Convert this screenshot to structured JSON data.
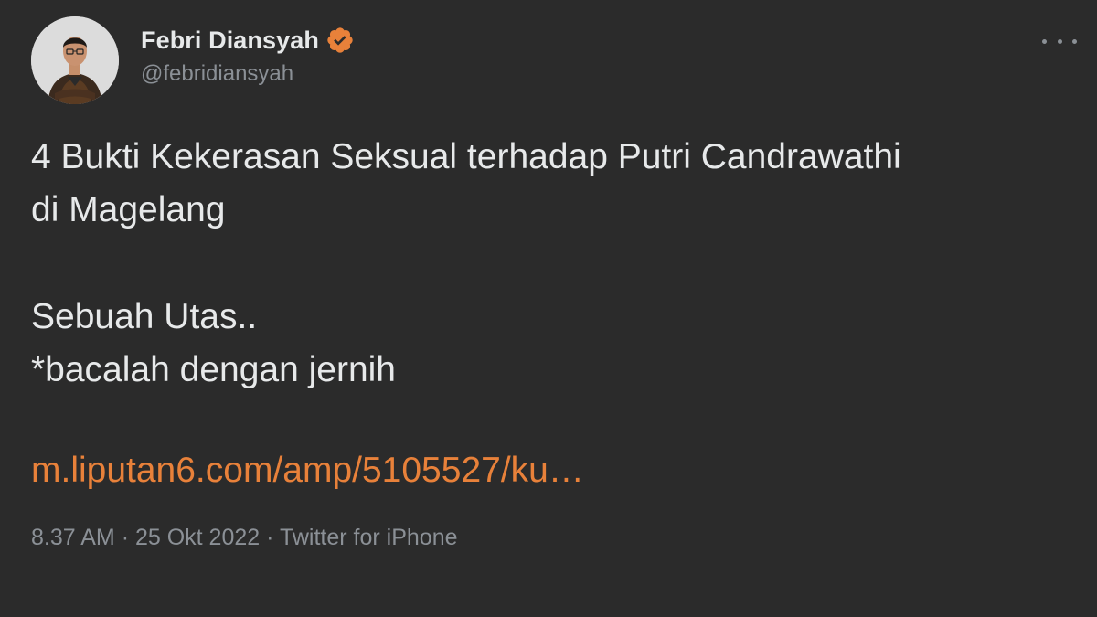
{
  "author": {
    "display_name": "Febri Diansyah",
    "handle": "@febridiansyah",
    "verified": true
  },
  "tweet": {
    "lines": [
      "4 Bukti Kekerasan Seksual terhadap Putri Candrawathi",
      "di Magelang",
      "Sebuah Utas..",
      "*bacalah dengan jernih"
    ],
    "link_text": "m.liputan6.com/amp/5105527/ku…"
  },
  "meta": {
    "time": "8.37 AM",
    "separator": "·",
    "date": "25 Okt 2022",
    "source": "Twitter for iPhone"
  },
  "colors": {
    "background": "#2b2b2b",
    "text": "#e7e9ea",
    "muted": "#8b9096",
    "accent": "#e8813a",
    "verified_badge": "#e8813a"
  },
  "icons": {
    "verified": "verified-badge-icon",
    "more": "more-options-icon"
  }
}
